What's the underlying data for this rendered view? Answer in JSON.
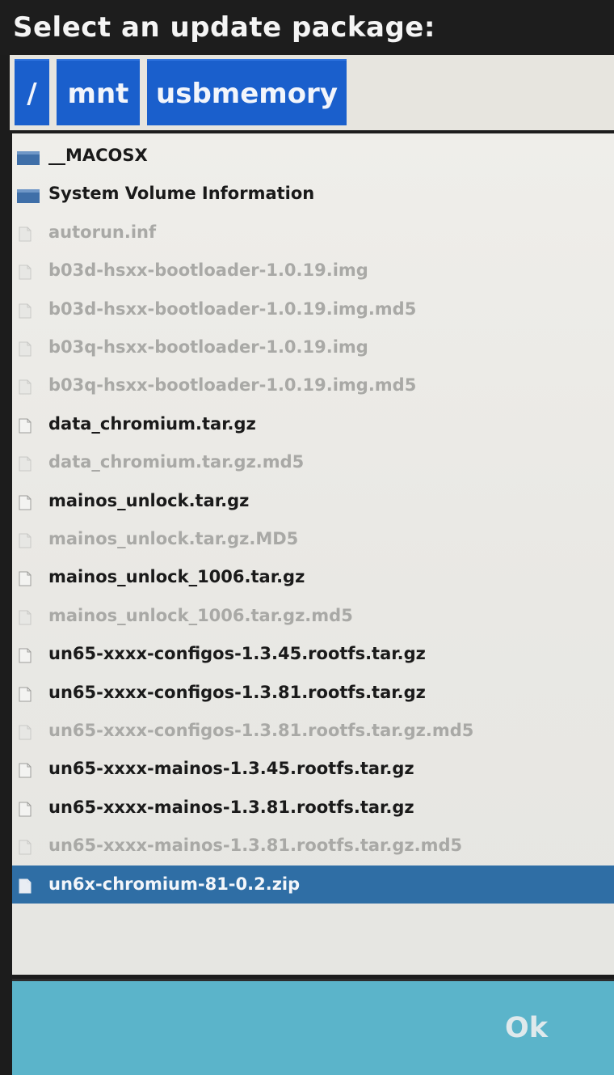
{
  "dialog": {
    "title": "Select an update package:"
  },
  "path": {
    "crumbs": [
      {
        "label": "/"
      },
      {
        "label": "mnt"
      },
      {
        "label": "usbmemory"
      }
    ]
  },
  "files": [
    {
      "name": "__MACOSX",
      "type": "folder",
      "state": "normal"
    },
    {
      "name": "System Volume Information",
      "type": "folder",
      "state": "normal"
    },
    {
      "name": "autorun.inf",
      "type": "file",
      "state": "disabled"
    },
    {
      "name": "b03d-hsxx-bootloader-1.0.19.img",
      "type": "file",
      "state": "disabled"
    },
    {
      "name": "b03d-hsxx-bootloader-1.0.19.img.md5",
      "type": "file",
      "state": "disabled"
    },
    {
      "name": "b03q-hsxx-bootloader-1.0.19.img",
      "type": "file",
      "state": "disabled"
    },
    {
      "name": "b03q-hsxx-bootloader-1.0.19.img.md5",
      "type": "file",
      "state": "disabled"
    },
    {
      "name": "data_chromium.tar.gz",
      "type": "file",
      "state": "normal"
    },
    {
      "name": "data_chromium.tar.gz.md5",
      "type": "file",
      "state": "disabled"
    },
    {
      "name": "mainos_unlock.tar.gz",
      "type": "file",
      "state": "normal"
    },
    {
      "name": "mainos_unlock.tar.gz.MD5",
      "type": "file",
      "state": "disabled"
    },
    {
      "name": "mainos_unlock_1006.tar.gz",
      "type": "file",
      "state": "normal"
    },
    {
      "name": "mainos_unlock_1006.tar.gz.md5",
      "type": "file",
      "state": "disabled"
    },
    {
      "name": "un65-xxxx-configos-1.3.45.rootfs.tar.gz",
      "type": "file",
      "state": "normal"
    },
    {
      "name": "un65-xxxx-configos-1.3.81.rootfs.tar.gz",
      "type": "file",
      "state": "normal"
    },
    {
      "name": "un65-xxxx-configos-1.3.81.rootfs.tar.gz.md5",
      "type": "file",
      "state": "disabled"
    },
    {
      "name": "un65-xxxx-mainos-1.3.45.rootfs.tar.gz",
      "type": "file",
      "state": "normal"
    },
    {
      "name": "un65-xxxx-mainos-1.3.81.rootfs.tar.gz",
      "type": "file",
      "state": "normal"
    },
    {
      "name": "un65-xxxx-mainos-1.3.81.rootfs.tar.gz.md5",
      "type": "file",
      "state": "disabled"
    },
    {
      "name": "un6x-chromium-81-0.2.zip",
      "type": "file",
      "state": "selected"
    }
  ],
  "actions": {
    "ok_label": "Ok"
  },
  "colors": {
    "title_bar": "#1d1d1d",
    "crumb": "#1a5fcc",
    "selection": "#2f6ea5",
    "folder_icon": "#3f6fa8",
    "enabled_text": "#1a1a1a",
    "disabled_text": "#a9a9a6",
    "bottom_bar": "#5bb4ca"
  }
}
